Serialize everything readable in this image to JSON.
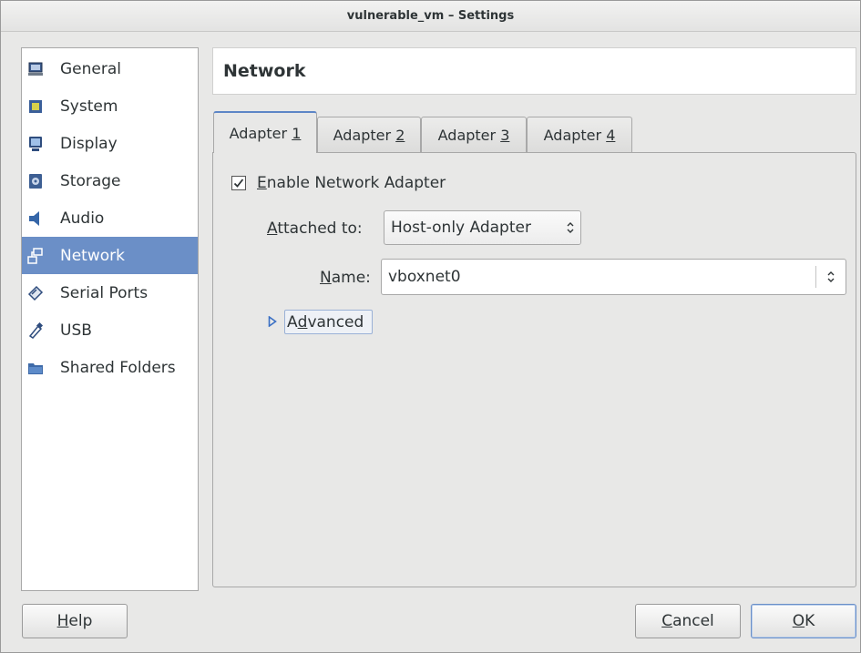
{
  "window": {
    "title": "vulnerable_vm – Settings"
  },
  "sidebar": {
    "items": [
      {
        "label": "General",
        "icon": "monitor-icon"
      },
      {
        "label": "System",
        "icon": "chip-icon"
      },
      {
        "label": "Display",
        "icon": "display-icon"
      },
      {
        "label": "Storage",
        "icon": "disk-icon"
      },
      {
        "label": "Audio",
        "icon": "speaker-icon"
      },
      {
        "label": "Network",
        "icon": "network-icon",
        "selected": true
      },
      {
        "label": "Serial Ports",
        "icon": "serial-port-icon"
      },
      {
        "label": "USB",
        "icon": "usb-icon"
      },
      {
        "label": "Shared Folders",
        "icon": "folder-icon"
      }
    ]
  },
  "page": {
    "title": "Network"
  },
  "tabs": [
    {
      "label": "Adapter ",
      "mnemonic": "1",
      "active": true
    },
    {
      "label": "Adapter ",
      "mnemonic": "2"
    },
    {
      "label": "Adapter ",
      "mnemonic": "3"
    },
    {
      "label": "Adapter ",
      "mnemonic": "4"
    }
  ],
  "adapter": {
    "enable_mnemonic": "E",
    "enable_label_rest": "nable Network Adapter",
    "enabled": true,
    "attached_mnemonic": "A",
    "attached_label_rest": "ttached to:",
    "attached_value": "Host-only Adapter",
    "name_mnemonic": "N",
    "name_label_rest": "ame:",
    "name_value": "vboxnet0",
    "advanced_pre": "A",
    "advanced_mnemonic": "d",
    "advanced_rest": "vanced"
  },
  "footer": {
    "help_mnemonic": "H",
    "help_rest": "elp",
    "cancel_mnemonic": "C",
    "cancel_rest": "ancel",
    "ok_mnemonic": "O",
    "ok_rest": "K"
  },
  "colors": {
    "selection": "#6b8fc7",
    "active_tab_accent": "#5d86c7",
    "window_bg": "#e8e8e7"
  }
}
